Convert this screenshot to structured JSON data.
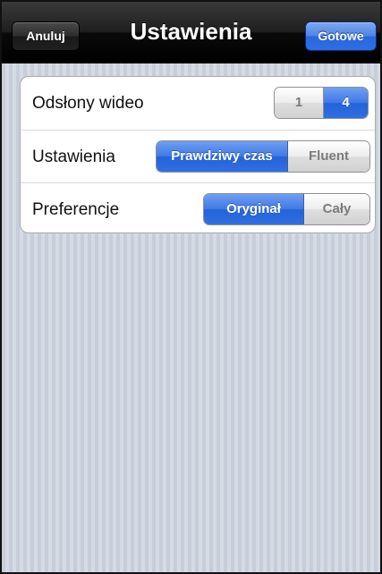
{
  "navbar": {
    "title": "Ustawienia",
    "cancel_label": "Anuluj",
    "done_label": "Gotowe"
  },
  "settings": {
    "rows": [
      {
        "label": "Odsłony wideo",
        "options": [
          "1",
          "4"
        ],
        "selected": "4"
      },
      {
        "label": "Ustawienia",
        "options": [
          "Prawdziwy czas",
          "Fluent"
        ],
        "selected": "Prawdziwy czas"
      },
      {
        "label": "Preferencje",
        "options": [
          "Oryginał",
          "Cały"
        ],
        "selected": "Oryginał"
      }
    ]
  },
  "colors": {
    "accent": "#2f6fe2",
    "navbar": "#1a1a1a",
    "background": "#cdd3dd"
  }
}
